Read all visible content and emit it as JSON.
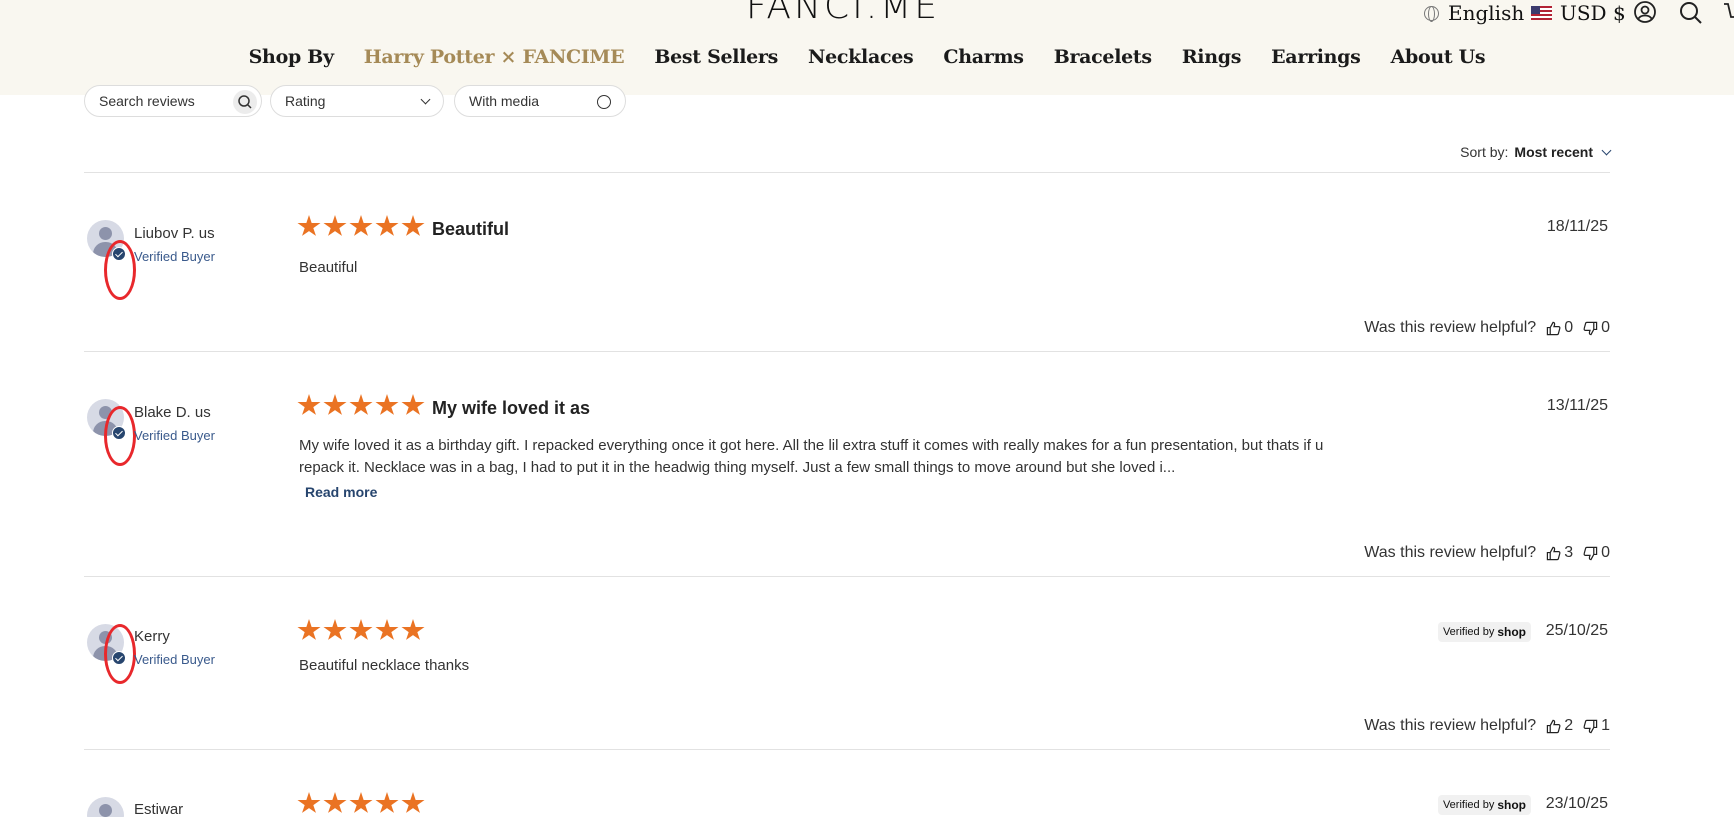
{
  "header": {
    "logo": "FANCI.ME",
    "language": "English",
    "currency": "USD $",
    "nav": [
      {
        "label": "Shop By"
      },
      {
        "label": "Harry Potter × FANCIME"
      },
      {
        "label": "Best Sellers"
      },
      {
        "label": "Necklaces"
      },
      {
        "label": "Charms"
      },
      {
        "label": "Bracelets"
      },
      {
        "label": "Rings"
      },
      {
        "label": "Earrings"
      },
      {
        "label": "About Us"
      }
    ],
    "icons": [
      "globe-icon",
      "us-flag-icon",
      "account-icon",
      "search-icon",
      "cart-icon"
    ]
  },
  "filters": {
    "search_placeholder": "Search reviews",
    "rating_label": "Rating",
    "media_label": "With media"
  },
  "sort": {
    "label": "Sort by:",
    "value": "Most recent"
  },
  "helpful_label": "Was this review helpful?",
  "verified_buyer_label": "Verified Buyer",
  "read_more_label": "Read more",
  "verified_by": {
    "prefix": "Verified by",
    "brand": "shop"
  },
  "colors": {
    "star": "#ea7323",
    "accent_nav": "#a58a57",
    "brand_blue": "#27456e",
    "annotation_red": "#e8282c"
  },
  "reviews": [
    {
      "name": "Liubov P.",
      "country": "us",
      "rating": 5,
      "title": "Beautiful",
      "date": "18/11/25",
      "body": "Beautiful",
      "up": "0",
      "down": "0"
    },
    {
      "name": "Blake D.",
      "country": "us",
      "rating": 5,
      "title": "My wife loved it as",
      "date": "13/11/25",
      "body": "My wife loved it as a birthday gift. I repacked everything once it got here. All the lil extra stuff it comes with really makes for a fun presentation, but thats if u repack it. Necklace was in a bag, I had to put it in the headwig thing myself. Just a few small things to move around but she loved i...",
      "up": "3",
      "down": "0"
    },
    {
      "name": "Kerry",
      "country": "",
      "rating": 5,
      "title": "",
      "date": "25/10/25",
      "body": "Beautiful necklace thanks",
      "up": "2",
      "down": "1"
    },
    {
      "name": "Estiwar",
      "country": "",
      "rating": 5,
      "title": "",
      "date": "23/10/25",
      "body": "",
      "up": "",
      "down": ""
    }
  ]
}
